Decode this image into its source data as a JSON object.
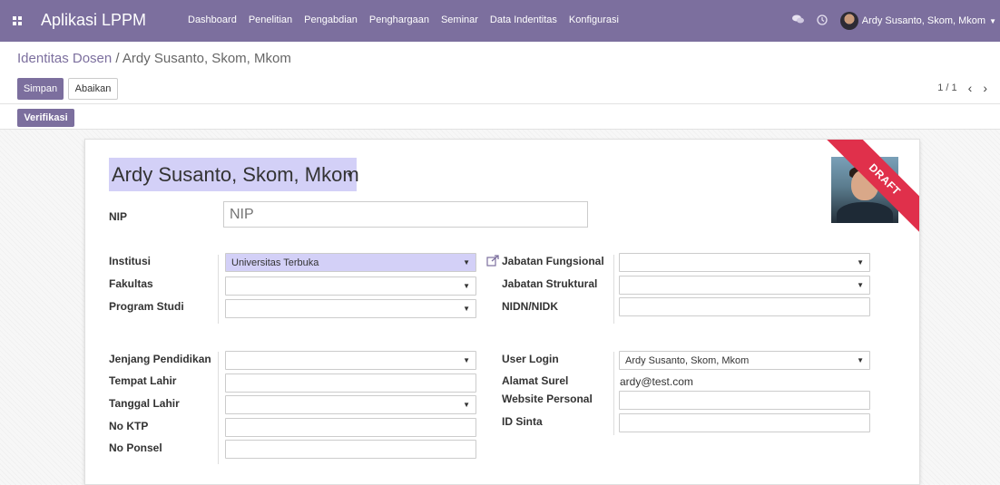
{
  "nav": {
    "brand": "Aplikasi LPPM",
    "menu": [
      "Dashboard",
      "Penelitian",
      "Pengabdian",
      "Penghargaan",
      "Seminar",
      "Data Indentitas",
      "Konfigurasi"
    ],
    "user": "Ardy Susanto, Skom, Mkom",
    "icons": {
      "apps": "apps-grid-icon",
      "chat": "chat-icon",
      "activity": "clock-icon"
    }
  },
  "breadcrumb": {
    "parent": "Identitas Dosen",
    "separator": " / ",
    "current": "Ardy Susanto, Skom, Mkom"
  },
  "buttons": {
    "save": "Simpan",
    "discard": "Abaikan",
    "verify": "Verifikasi"
  },
  "pager": {
    "value": "1 / 1",
    "prev": "‹",
    "next": "›"
  },
  "record": {
    "name": "Ardy Susanto, Skom, Mkom",
    "status_ribbon": "DRAFT",
    "nip": {
      "label": "NIP",
      "placeholder": "NIP"
    }
  },
  "left_group1": [
    {
      "label": "Institusi",
      "value": "Universitas Terbuka",
      "type": "select",
      "highlighted": true
    },
    {
      "label": "Fakultas",
      "value": "",
      "type": "select"
    },
    {
      "label": "Program Studi",
      "value": "",
      "type": "select"
    }
  ],
  "right_group1": [
    {
      "label": "Jabatan Fungsional",
      "value": "",
      "type": "select"
    },
    {
      "label": "Jabatan Struktural",
      "value": "",
      "type": "select"
    },
    {
      "label": "NIDN/NIDK",
      "value": "",
      "type": "text"
    }
  ],
  "left_group2": [
    {
      "label": "Jenjang Pendidikan",
      "value": "",
      "type": "select"
    },
    {
      "label": "Tempat Lahir",
      "value": "",
      "type": "text"
    },
    {
      "label": "Tanggal Lahir",
      "value": "",
      "type": "select"
    },
    {
      "label": "No KTP",
      "value": "",
      "type": "text"
    },
    {
      "label": "No Ponsel",
      "value": "",
      "type": "text"
    }
  ],
  "right_group2": [
    {
      "label": "User Login",
      "value": "Ardy Susanto, Skom, Mkom",
      "type": "select"
    },
    {
      "label": "Alamat Surel",
      "value": "ardy@test.com",
      "type": "readonly"
    },
    {
      "label": "Website Personal",
      "value": "",
      "type": "text"
    },
    {
      "label": "ID Sinta",
      "value": "",
      "type": "text"
    }
  ],
  "colors": {
    "brand": "#7c6f9e",
    "highlight": "#d3d0f7",
    "ribbon": "#e0304b"
  }
}
